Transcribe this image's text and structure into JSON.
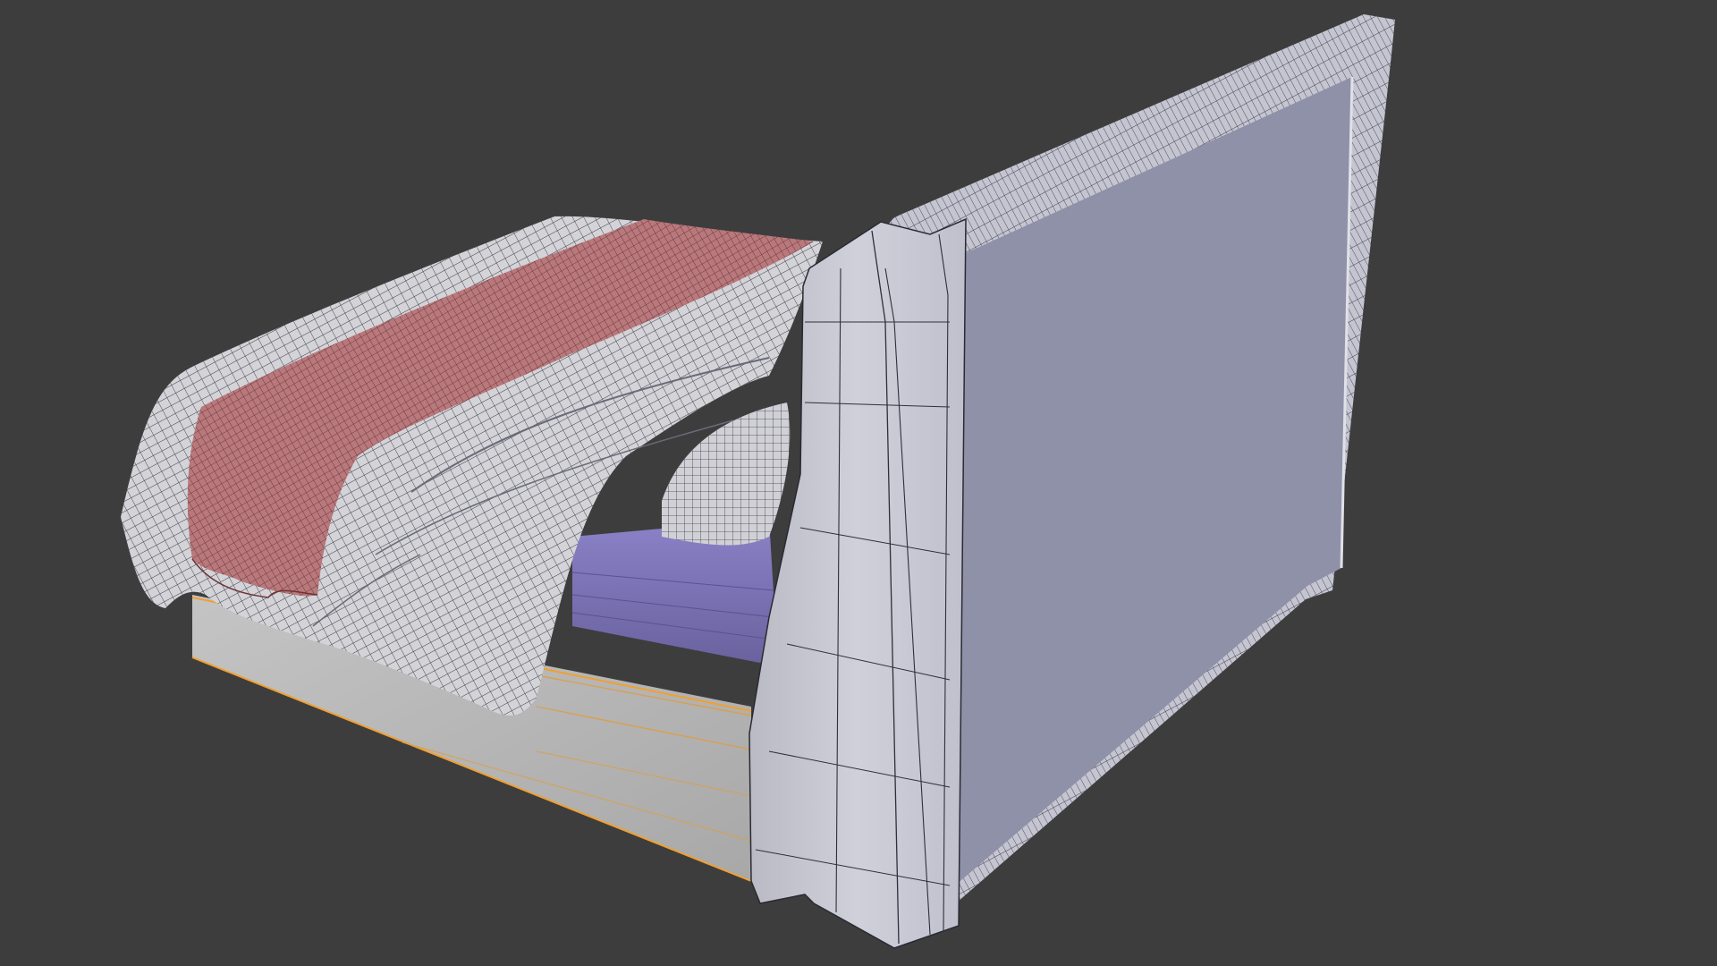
{
  "viewport": {
    "background": "#3d3d3d",
    "shading": "solid-wireframe"
  },
  "scene": {
    "object": "bed",
    "parts": [
      {
        "name": "headboard",
        "color": "#8e90a6"
      },
      {
        "name": "headboard-frame",
        "color": "#c9cad6"
      },
      {
        "name": "wing-panel",
        "color": "#c4c5cf"
      },
      {
        "name": "bed-base",
        "color": "#b2b2b2"
      },
      {
        "name": "mattress",
        "color": "#7b72b4"
      },
      {
        "name": "duvet",
        "color": "#d2d2d6"
      },
      {
        "name": "throw-blanket",
        "color": "#b7787a"
      },
      {
        "name": "pillow",
        "color": "#cfcfd4"
      }
    ],
    "selection_outline_color": "#f0a030"
  }
}
